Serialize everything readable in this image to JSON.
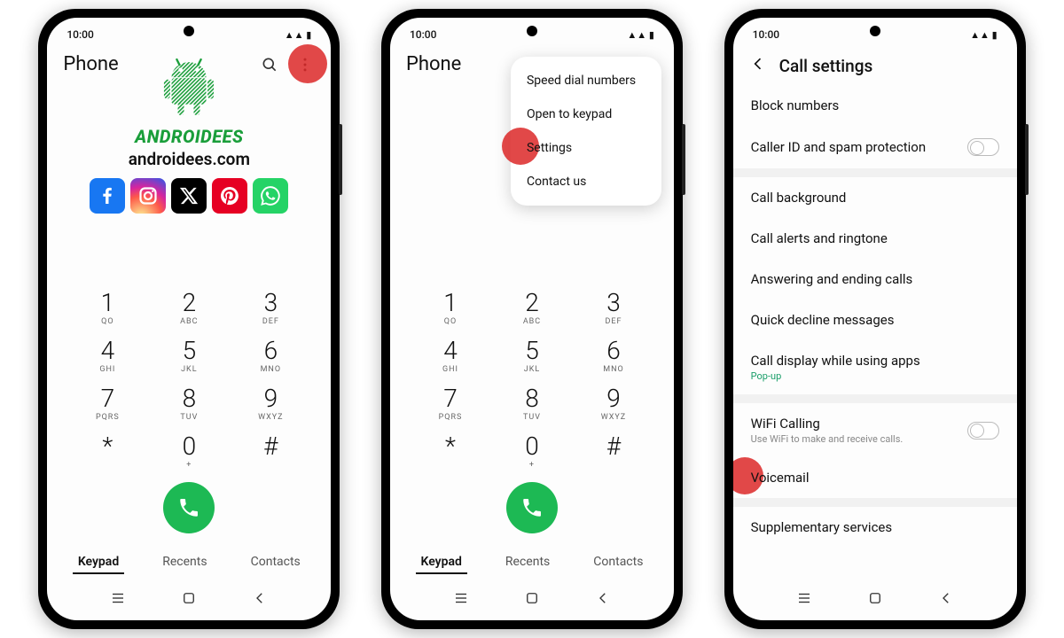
{
  "status": {
    "time": "10:00",
    "signal": "▲▲ ▮"
  },
  "phone_app": {
    "title": "Phone",
    "tabs": {
      "keypad": "Keypad",
      "recents": "Recents",
      "contacts": "Contacts"
    }
  },
  "keys": [
    {
      "n": "1",
      "s": "QO"
    },
    {
      "n": "2",
      "s": "ABC"
    },
    {
      "n": "3",
      "s": "DEF"
    },
    {
      "n": "4",
      "s": "GHI"
    },
    {
      "n": "5",
      "s": "JKL"
    },
    {
      "n": "6",
      "s": "MNO"
    },
    {
      "n": "7",
      "s": "PQRS"
    },
    {
      "n": "8",
      "s": "TUV"
    },
    {
      "n": "9",
      "s": "WXYZ"
    },
    {
      "n": "*",
      "s": ""
    },
    {
      "n": "0",
      "s": "+"
    },
    {
      "n": "#",
      "s": ""
    }
  ],
  "branding": {
    "name": "ANDROIDEES",
    "url": "androidees.com"
  },
  "menu": {
    "speed_dial": "Speed dial numbers",
    "open_keypad": "Open to keypad",
    "settings": "Settings",
    "contact_us": "Contact us"
  },
  "settings": {
    "title": "Call settings",
    "block_numbers": "Block numbers",
    "caller_id": "Caller ID and spam protection",
    "call_background": "Call background",
    "call_alerts": "Call alerts and ringtone",
    "answering": "Answering and ending calls",
    "quick_decline": "Quick decline messages",
    "call_display": "Call display while using apps",
    "call_display_sub": "Pop-up",
    "wifi_calling": "WiFi Calling",
    "wifi_calling_sub": "Use WiFi to make and receive calls.",
    "voicemail": "Voicemail",
    "supplementary": "Supplementary services"
  }
}
